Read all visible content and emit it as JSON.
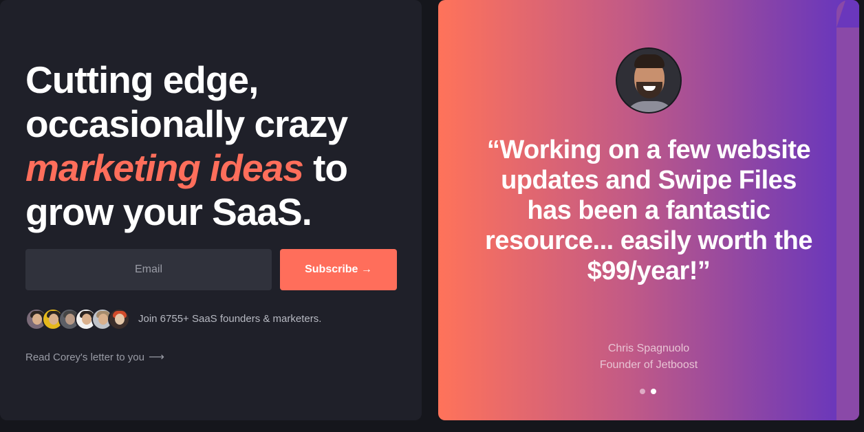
{
  "hero": {
    "headline_line1": "Cutting edge,",
    "headline_line2": "occasionally crazy",
    "headline_accent": "marketing ideas",
    "headline_after_accent": " to",
    "headline_line4": "grow your SaaS."
  },
  "signup": {
    "email_placeholder": "Email",
    "email_value": "",
    "subscribe_label": "Subscribe →"
  },
  "social_proof": {
    "avatar_count": 6,
    "join_text": "Join 6755+ SaaS founders & marketers."
  },
  "letter_link": {
    "label": "Read Corey's letter to you",
    "arrow": "⟶"
  },
  "testimonial": {
    "quote": "“Working on a few website updates and Swipe Files has been a fantastic resource... easily worth the $99/year!”",
    "author_name": "Chris Spagnuolo",
    "author_title": "Founder of Jetboost",
    "slide_count": 2,
    "active_slide": 2
  },
  "colors": {
    "accent": "#ff6e5b",
    "card_bg": "#1f2029",
    "gradient_start": "#ff735a",
    "gradient_end": "#6234c0"
  }
}
